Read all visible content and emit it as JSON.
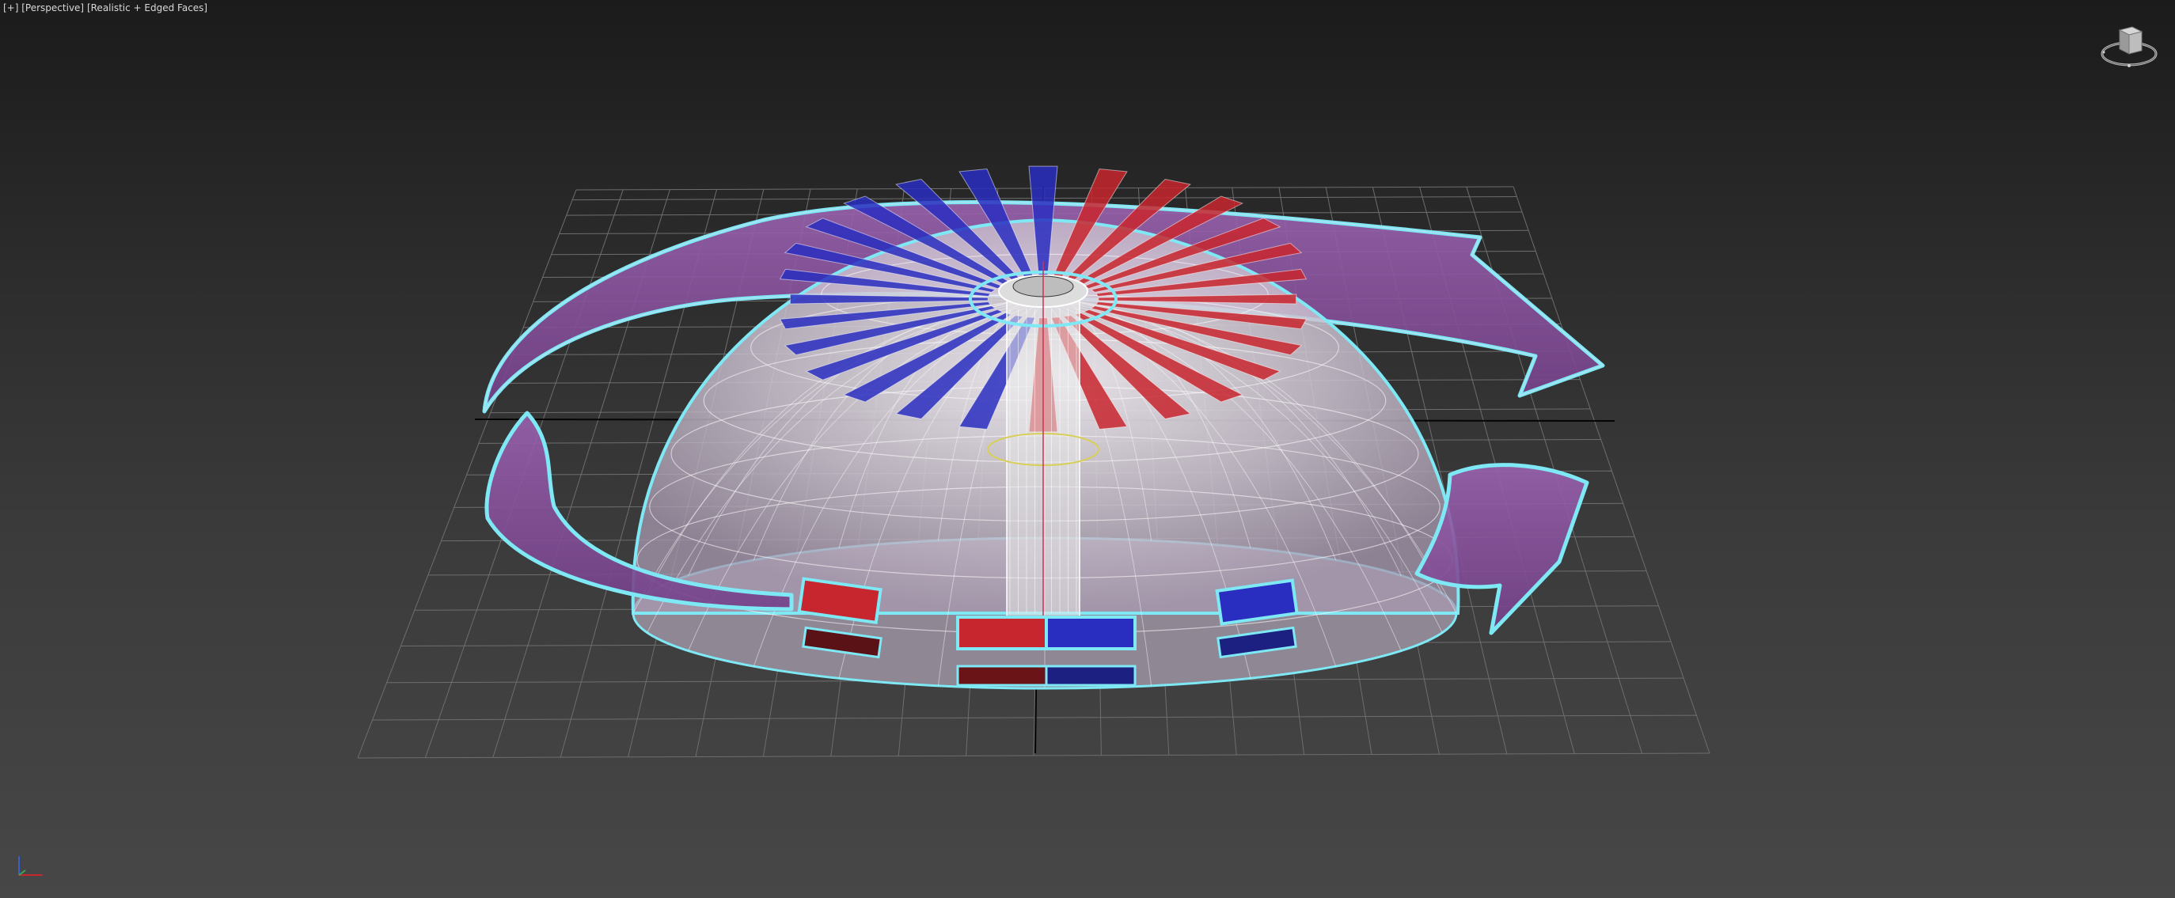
{
  "viewport": {
    "menu_plus": "[+]",
    "view_name": "[Perspective]",
    "shading_mode": "[Realistic + Edged Faces]"
  },
  "colors": {
    "background_top": "#1b1b1b",
    "background_bottom": "#474747",
    "grid": "#6e6e6e",
    "axis_line": "#050505",
    "selection_outline": "#7fe8f5",
    "dome": "#c9c2cc",
    "arrow_band": "#8a4f9e",
    "red_blade": "#c8262e",
    "blue_blade": "#2a2ec0",
    "hub": "#e8e8e8"
  },
  "icons": {
    "viewcube": "viewcube-icon",
    "axis_tripod": "axis-tripod-icon"
  }
}
